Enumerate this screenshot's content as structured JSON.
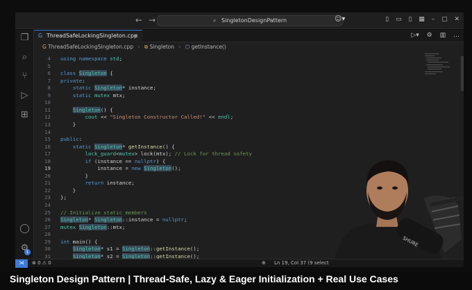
{
  "window": {
    "search_text": "SingletonDesignPattern",
    "nav_back": "←",
    "nav_forward": "→"
  },
  "tab": {
    "filename": "ThreadSafeLockingSingleton.cpp",
    "close": "×",
    "icon": "cpp-file-icon"
  },
  "breadcrumb": {
    "file": "ThreadSafeLockingSingleton.cpp",
    "class": "Singleton",
    "method": "getInstance()"
  },
  "editor": {
    "current_line": "19",
    "lines": [
      {
        "n": "4",
        "text": "using namespace std;"
      },
      {
        "n": "5",
        "text": ""
      },
      {
        "n": "6",
        "text": "class Singleton {"
      },
      {
        "n": "7",
        "text": "private:"
      },
      {
        "n": "8",
        "text": "    static Singleton* instance;"
      },
      {
        "n": "9",
        "text": "    static mutex mtx;"
      },
      {
        "n": "10",
        "text": ""
      },
      {
        "n": "11",
        "text": "    Singleton() {"
      },
      {
        "n": "12",
        "text": "        cout << \"Singleton Constructor Called!\" << endl;"
      },
      {
        "n": "13",
        "text": "    }"
      },
      {
        "n": "14",
        "text": ""
      },
      {
        "n": "15",
        "text": "public:"
      },
      {
        "n": "16",
        "text": "    static Singleton* getInstance() {"
      },
      {
        "n": "17",
        "text": "        lock_guard<mutex> lock(mtx); // Lock for thread safety"
      },
      {
        "n": "18",
        "text": "        if (instance == nullptr) {"
      },
      {
        "n": "19",
        "text": "            instance = new Singleton();"
      },
      {
        "n": "20",
        "text": "        }"
      },
      {
        "n": "21",
        "text": "        return instance;"
      },
      {
        "n": "22",
        "text": "    }"
      },
      {
        "n": "23",
        "text": "};"
      },
      {
        "n": "24",
        "text": ""
      },
      {
        "n": "25",
        "text": "// Initialize static members"
      },
      {
        "n": "26",
        "text": "Singleton* Singleton::instance = nullptr;"
      },
      {
        "n": "27",
        "text": "mutex Singleton::mtx;"
      },
      {
        "n": "28",
        "text": ""
      },
      {
        "n": "29",
        "text": "int main() {"
      },
      {
        "n": "30",
        "text": "    Singleton* s1 = Singleton::getInstance();"
      },
      {
        "n": "31",
        "text": "    Singleton* s2 = Singleton::getInstance();"
      }
    ]
  },
  "status": {
    "remote_icon": "remote-icon",
    "errors": "⊗ 0 ⚠ 0",
    "zoom_icon": "zoom-icon",
    "position": "Ln 19, Col 37 (9 select"
  },
  "account_badge": "1",
  "video_title": "Singleton Design Pattern | Thread-Safe, Lazy & Eager Initialization + Real Use Cases"
}
